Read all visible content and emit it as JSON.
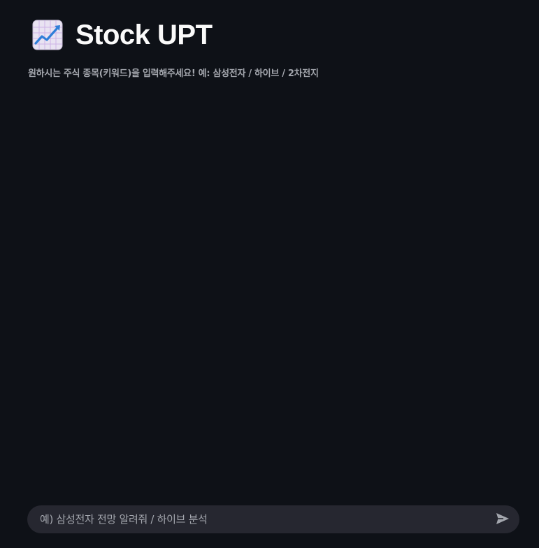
{
  "header": {
    "icon": "chart-increasing-icon",
    "title": "Stock UPT"
  },
  "caption": "원하시는 주식 종목(키워드)을 입력해주세요! 예: 삼성전자 / 하이브 / 2차전지",
  "chat_input": {
    "placeholder": "예) 삼성전자 전망 알려줘 / 하이브 분석",
    "value": "",
    "send_icon": "send-icon"
  },
  "colors": {
    "background": "#0e1117",
    "input_background": "#262730",
    "title_text": "#fafafa",
    "muted_text": "#a3a6ad"
  }
}
